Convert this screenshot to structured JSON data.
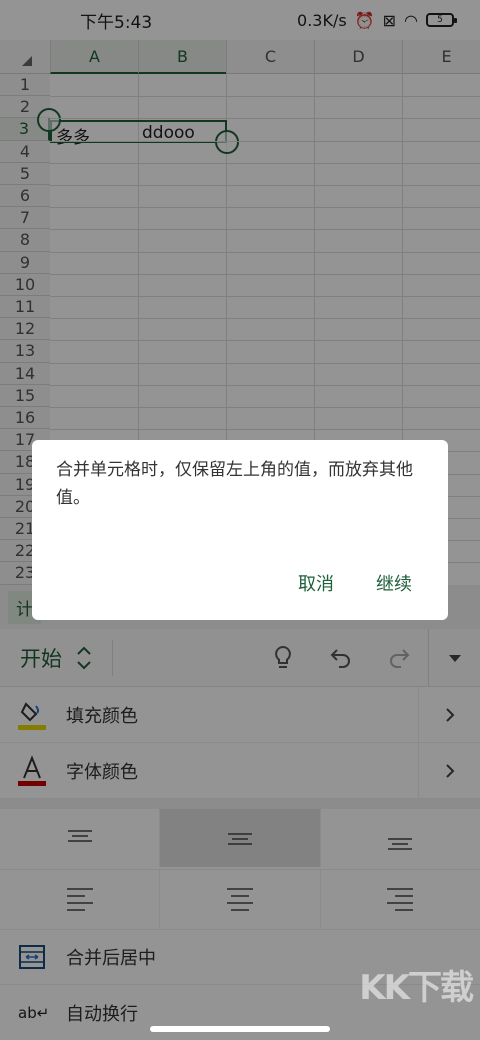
{
  "status_bar": {
    "time": "下午5:43",
    "speed": "0.3K/s",
    "battery": "5"
  },
  "sheet": {
    "columns": [
      "A",
      "B",
      "C",
      "D",
      "E"
    ],
    "rows": [
      "1",
      "2",
      "3",
      "4",
      "5",
      "6",
      "7",
      "8",
      "9",
      "10",
      "11",
      "12",
      "13",
      "14",
      "15",
      "16",
      "17",
      "18",
      "19",
      "20",
      "21",
      "22",
      "23"
    ],
    "cells": {
      "A3": "多多",
      "B3": "ddooo"
    }
  },
  "sheet_tab": {
    "label": "计"
  },
  "toolbar": {
    "start_label": "开始",
    "icons": [
      "lightbulb-icon",
      "undo-icon",
      "redo-icon",
      "dropdown-arrow-icon"
    ]
  },
  "panel": {
    "fill_color_label": "填充颜色",
    "font_color_label": "字体颜色",
    "merge_center_label": "合并后居中",
    "auto_wrap_label": "自动换行",
    "fill_color_swatch": "#e4d800",
    "font_color_swatch": "#c40000"
  },
  "dialog": {
    "message": "合并单元格时，仅保留左上角的值，而放弃其他值。",
    "cancel_label": "取消",
    "continue_label": "继续"
  },
  "watermark": {
    "text": "KK下载"
  },
  "colors": {
    "accent": "#1f5f3a"
  }
}
